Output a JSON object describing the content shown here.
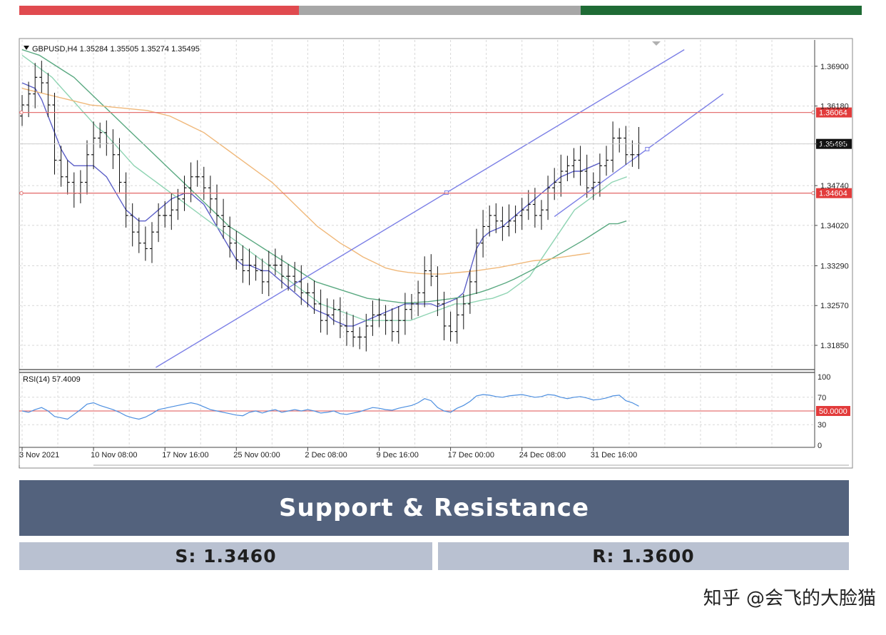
{
  "colors": {
    "bar_red": "#e04a4f",
    "bar_gray": "#a7a7a7",
    "bar_green": "#1f6b35",
    "banner": "#53627d",
    "level_box": "#b9c1d1",
    "hline": "#e57373",
    "channel": "#7b7fe6",
    "ma_fast": "#5b5fc7",
    "ma_mid": "#8fd4b3",
    "ma_slow": "#5aa981",
    "ma_long": "#f0b87a",
    "rsi": "#4d8fe0"
  },
  "chart_data": [
    {
      "type": "line",
      "title": "GBPUSD,H4 1.35284 1.35505 1.35274 1.35495",
      "symbol": "GBPUSD,H4",
      "ohlc": {
        "open": "1.35284",
        "high": "1.35505",
        "low": "1.35274",
        "close": "1.35495"
      },
      "ylim": [
        1.3145,
        1.3735
      ],
      "y_ticks": [
        "1.36900",
        "1.36180",
        "1.35495",
        "1.34740",
        "1.34020",
        "1.33290",
        "1.32570",
        "1.31850"
      ],
      "x_labels": [
        "3 Nov 2021",
        "10 Nov 08:00",
        "17 Nov 16:00",
        "25 Nov 00:00",
        "2 Dec 08:00",
        "9 Dec 16:00",
        "17 Dec 00:00",
        "24 Dec 08:00",
        "31 Dec 16:00"
      ],
      "x_label_index": [
        0,
        11,
        22,
        33,
        44,
        55,
        66,
        77,
        88
      ],
      "n_bars": 96,
      "closes": [
        1.362,
        1.364,
        1.367,
        1.366,
        1.362,
        1.352,
        1.349,
        1.348,
        1.346,
        1.348,
        1.353,
        1.356,
        1.357,
        1.355,
        1.353,
        1.348,
        1.342,
        1.339,
        1.337,
        1.336,
        1.339,
        1.342,
        1.342,
        1.343,
        1.345,
        1.347,
        1.349,
        1.349,
        1.347,
        1.345,
        1.342,
        1.34,
        1.337,
        1.334,
        1.332,
        1.333,
        1.332,
        1.33,
        1.333,
        1.333,
        1.331,
        1.331,
        1.33,
        1.328,
        1.328,
        1.326,
        1.323,
        1.324,
        1.325,
        1.322,
        1.321,
        1.32,
        1.32,
        1.322,
        1.324,
        1.324,
        1.323,
        1.321,
        1.323,
        1.325,
        1.326,
        1.328,
        1.332,
        1.331,
        1.326,
        1.322,
        1.321,
        1.324,
        1.326,
        1.33,
        1.337,
        1.34,
        1.342,
        1.341,
        1.34,
        1.341,
        1.342,
        1.343,
        1.344,
        1.342,
        1.343,
        1.347,
        1.348,
        1.35,
        1.351,
        1.352,
        1.35,
        1.347,
        1.348,
        1.351,
        1.352,
        1.356,
        1.356,
        1.353,
        1.353,
        1.355
      ],
      "h_lines": [
        {
          "value": 1.36064,
          "label": "1.36064"
        },
        {
          "value": 1.34604,
          "label": "1.34604"
        }
      ],
      "current_price": {
        "value": 1.35495,
        "label": "1.35495"
      },
      "channel_lines": [
        {
          "x": [
            20.6,
            102
          ],
          "y": [
            1.3145,
            1.372
          ]
        },
        {
          "x": [
            82,
            108
          ],
          "y": [
            1.3418,
            1.364
          ]
        }
      ],
      "moving_averages": [
        {
          "style": "fast",
          "values": [
            1.366,
            1.3655,
            1.365,
            1.363,
            1.36,
            1.357,
            1.354,
            1.352,
            1.351,
            1.351,
            1.351,
            1.351,
            1.35,
            1.349,
            1.347,
            1.345,
            1.343,
            1.342,
            1.341,
            1.341,
            1.342,
            1.343,
            1.344,
            1.345,
            1.3455,
            1.346,
            1.346,
            1.345,
            1.344,
            1.342,
            1.34,
            1.338,
            1.336,
            1.334,
            1.333,
            1.333,
            1.3325,
            1.332,
            1.332,
            1.331,
            1.33,
            1.329,
            1.328,
            1.327,
            1.326,
            1.325,
            1.3245,
            1.324,
            1.323,
            1.3225,
            1.322,
            1.322,
            1.3225,
            1.323,
            1.3235,
            1.324,
            1.3245,
            1.325,
            1.3255,
            1.326,
            1.326,
            1.326,
            1.326,
            1.326,
            1.3255,
            1.326,
            1.3265,
            1.327,
            1.328,
            1.332,
            1.336,
            1.338,
            1.339,
            1.3395,
            1.34,
            1.341,
            1.342,
            1.343,
            1.344,
            1.345,
            1.346,
            1.347,
            1.348,
            1.349,
            1.3495,
            1.35,
            1.35,
            1.3505,
            1.351,
            1.3515
          ]
        },
        {
          "style": "mid",
          "values": [
            1.371,
            1.37,
            1.369,
            1.368,
            1.367,
            1.3655,
            1.364,
            1.3625,
            1.361,
            1.3595,
            1.358,
            1.357,
            1.3555,
            1.354,
            1.3525,
            1.351,
            1.35,
            1.349,
            1.348,
            1.347,
            1.346,
            1.345,
            1.344,
            1.343,
            1.342,
            1.341,
            1.34,
            1.339,
            1.338,
            1.337,
            1.336,
            1.335,
            1.334,
            1.333,
            1.332,
            1.331,
            1.33,
            1.329,
            1.328,
            1.327,
            1.326,
            1.3255,
            1.325,
            1.3245,
            1.324,
            1.3235,
            1.323,
            1.323,
            1.323,
            1.323,
            1.323,
            1.323,
            1.323,
            1.3235,
            1.324,
            1.3245,
            1.325,
            1.3255,
            1.326,
            1.326,
            1.3262,
            1.3265,
            1.3268,
            1.327,
            1.3275,
            1.328,
            1.329,
            1.33,
            1.331,
            1.333,
            1.335,
            1.337,
            1.339,
            1.341,
            1.343,
            1.344,
            1.345,
            1.346,
            1.347,
            1.348,
            1.3485,
            1.349
          ]
        },
        {
          "style": "slow",
          "values": [
            1.372,
            1.3715,
            1.371,
            1.37,
            1.369,
            1.368,
            1.367,
            1.3655,
            1.364,
            1.3625,
            1.361,
            1.3595,
            1.358,
            1.3565,
            1.355,
            1.3535,
            1.352,
            1.3505,
            1.349,
            1.3475,
            1.346,
            1.3445,
            1.343,
            1.3415,
            1.34,
            1.339,
            1.338,
            1.337,
            1.336,
            1.335,
            1.334,
            1.333,
            1.332,
            1.331,
            1.33,
            1.3295,
            1.329,
            1.3285,
            1.328,
            1.3275,
            1.327,
            1.3268,
            1.3266,
            1.3264,
            1.3262,
            1.3262,
            1.3263,
            1.3264,
            1.3266,
            1.3268,
            1.327,
            1.3273,
            1.3277,
            1.3281,
            1.3286,
            1.3292,
            1.3298,
            1.3305,
            1.3313,
            1.3321,
            1.333,
            1.3339,
            1.3348,
            1.3357,
            1.3366,
            1.3375,
            1.3385,
            1.3395,
            1.3405,
            1.3405,
            1.341
          ]
        },
        {
          "style": "long",
          "values": [
            1.365,
            1.3645,
            1.364,
            1.3635,
            1.363,
            1.3625,
            1.362,
            1.3618,
            1.3616,
            1.3614,
            1.3612,
            1.361,
            1.3605,
            1.36,
            1.359,
            1.358,
            1.357,
            1.3555,
            1.354,
            1.3525,
            1.351,
            1.3495,
            1.348,
            1.346,
            1.344,
            1.342,
            1.34,
            1.3385,
            1.337,
            1.3358,
            1.3345,
            1.3335,
            1.3325,
            1.332,
            1.3317,
            1.3315,
            1.3314,
            1.3314,
            1.3316,
            1.3318,
            1.332,
            1.3323,
            1.3326,
            1.333,
            1.3334,
            1.3338,
            1.334,
            1.3343,
            1.3346,
            1.3349,
            1.3352
          ]
        }
      ]
    },
    {
      "type": "line",
      "title": "RSI(14) 57.4009",
      "ylim": [
        0,
        100
      ],
      "y_ticks": [
        "100",
        "70",
        "50",
        "30",
        "0"
      ],
      "level": {
        "value": 50,
        "label": "50.0000"
      },
      "values": [
        50,
        48,
        52,
        55,
        50,
        42,
        40,
        38,
        45,
        52,
        60,
        62,
        58,
        55,
        52,
        48,
        43,
        40,
        38,
        41,
        46,
        52,
        54,
        56,
        58,
        60,
        62,
        60,
        56,
        52,
        50,
        48,
        46,
        44,
        43,
        48,
        50,
        47,
        50,
        52,
        48,
        50,
        52,
        50,
        52,
        50,
        47,
        48,
        50,
        46,
        45,
        47,
        49,
        52,
        55,
        54,
        52,
        51,
        54,
        56,
        58,
        62,
        68,
        65,
        55,
        50,
        48,
        54,
        58,
        64,
        72,
        74,
        73,
        71,
        70,
        72,
        73,
        74,
        72,
        70,
        71,
        74,
        73,
        70,
        68,
        70,
        71,
        69,
        66,
        67,
        69,
        72,
        73,
        65,
        62,
        57
      ]
    }
  ],
  "banner": {
    "title": "Support & Resistance"
  },
  "levels": {
    "support": "S: 1.3460",
    "resistance": "R: 1.3600"
  },
  "watermark": "知乎 @会飞的大脸猫"
}
